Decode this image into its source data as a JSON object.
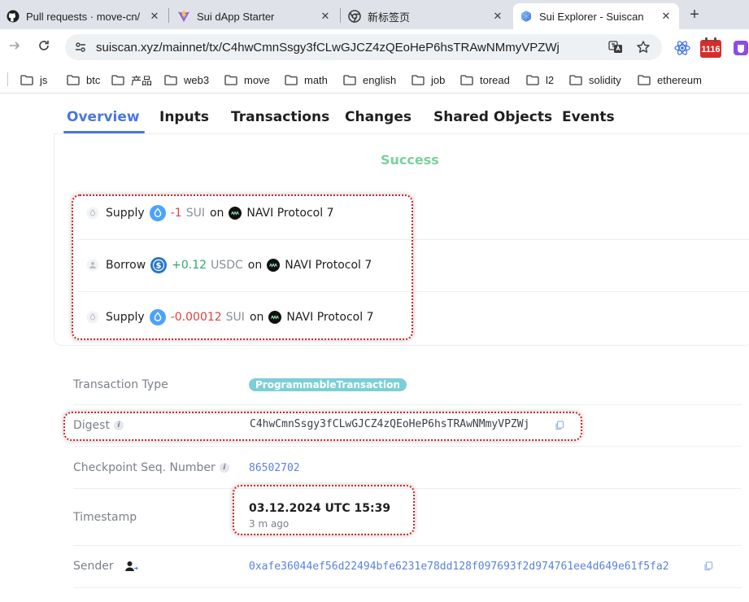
{
  "browser": {
    "tabs": [
      {
        "title": "Pull requests · move-cn/",
        "icon": "github-icon"
      },
      {
        "title": "Sui dApp Starter",
        "icon": "vite-icon"
      },
      {
        "title": "新标签页",
        "icon": "chrome-icon"
      },
      {
        "title": "Sui Explorer - Suiscan",
        "icon": "suiscan-icon"
      }
    ],
    "close_glyph": "✕",
    "new_tab_glyph": "+",
    "url": "suiscan.xyz/mainnet/tx/C4hwCmnSsgy3fCLwGJCZ4zQEoHeP6hsTRAwNMmyVPZWj",
    "extension_badge": "1116",
    "bookmarks": [
      "js",
      "btc",
      "产品",
      "web3",
      "move",
      "math",
      "english",
      "job",
      "toread",
      "l2",
      "solidity",
      "ethereum"
    ]
  },
  "page": {
    "tabs": [
      "Overview",
      "Inputs",
      "Transactions",
      "Changes",
      "Shared Objects",
      "Events"
    ],
    "status": "Success",
    "activities": [
      {
        "verb": "Supply",
        "amount": "-1",
        "symbol": "SUI",
        "on": "on",
        "protocol": "NAVI Protocol 7",
        "sign": "neg"
      },
      {
        "verb": "Borrow",
        "amount": "+0.12",
        "symbol": "USDC",
        "on": "on",
        "protocol": "NAVI Protocol 7",
        "sign": "pos"
      },
      {
        "verb": "Supply",
        "amount": "-0.00012",
        "symbol": "SUI",
        "on": "on",
        "protocol": "NAVI Protocol 7",
        "sign": "neg"
      }
    ],
    "details": {
      "tx_type_label": "Transaction Type",
      "tx_type_value": "ProgrammableTransaction",
      "digest_label": "Digest",
      "digest_value": "C4hwCmnSsgy3fCLwGJCZ4zQEoHeP6hsTRAwNMmyVPZWj",
      "checkpoint_label": "Checkpoint Seq. Number",
      "checkpoint_value": "86502702",
      "timestamp_label": "Timestamp",
      "timestamp_value": "03.12.2024 UTC 15:39",
      "timestamp_relative": "3 m ago",
      "sender_label": "Sender",
      "sender_value": "0xafe36044ef56d22494bfe6231e78dd128f097693f2d974761ee4d649e61f5fa2",
      "info_glyph": "i"
    }
  },
  "colors": {
    "accent": "#4a76e0",
    "success": "#7ad19b",
    "negative": "#e0403a",
    "positive": "#2faa62",
    "highlight": "#d11f1f"
  }
}
